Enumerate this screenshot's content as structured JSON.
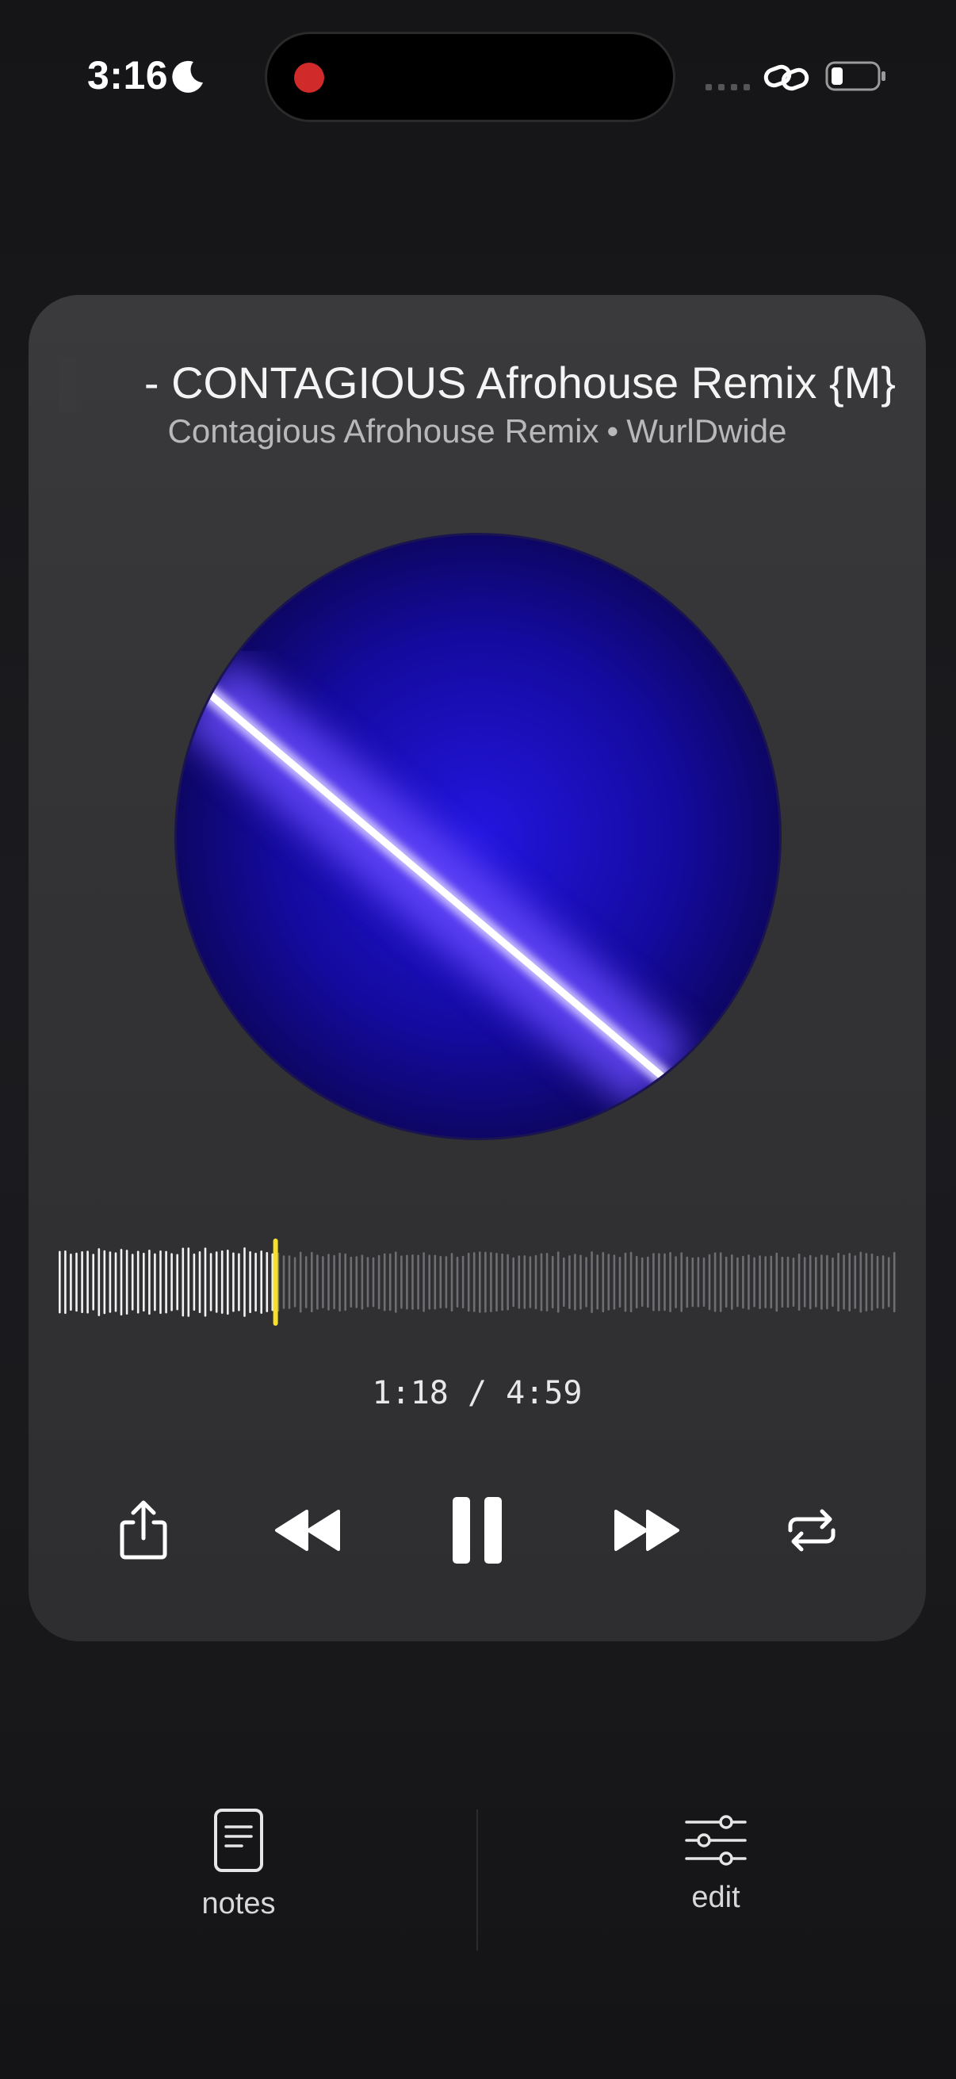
{
  "status_bar": {
    "time": "3:16",
    "icons": [
      "moon-icon",
      "recording-indicator",
      "signal-dots-icon",
      "link-icon",
      "battery-icon"
    ],
    "recording_color": "#d02a2a"
  },
  "player": {
    "title": "- CONTAGIOUS Afrohouse Remix {M}",
    "album": "Contagious Afrohouse Remix",
    "separator": "•",
    "artist": "WurlDwide",
    "elapsed": "1:18",
    "time_separator": "/",
    "duration": "4:59",
    "progress_fraction": 0.26,
    "progress_color": "#f5e02a",
    "artwork_colors": [
      "#1a10c8",
      "#0a0650",
      "#ffffff"
    ],
    "controls": [
      "share-icon",
      "rewind-icon",
      "pause-icon",
      "fast-forward-icon",
      "repeat-icon"
    ]
  },
  "bottom_bar": {
    "notes_label": "notes",
    "edit_label": "edit"
  }
}
